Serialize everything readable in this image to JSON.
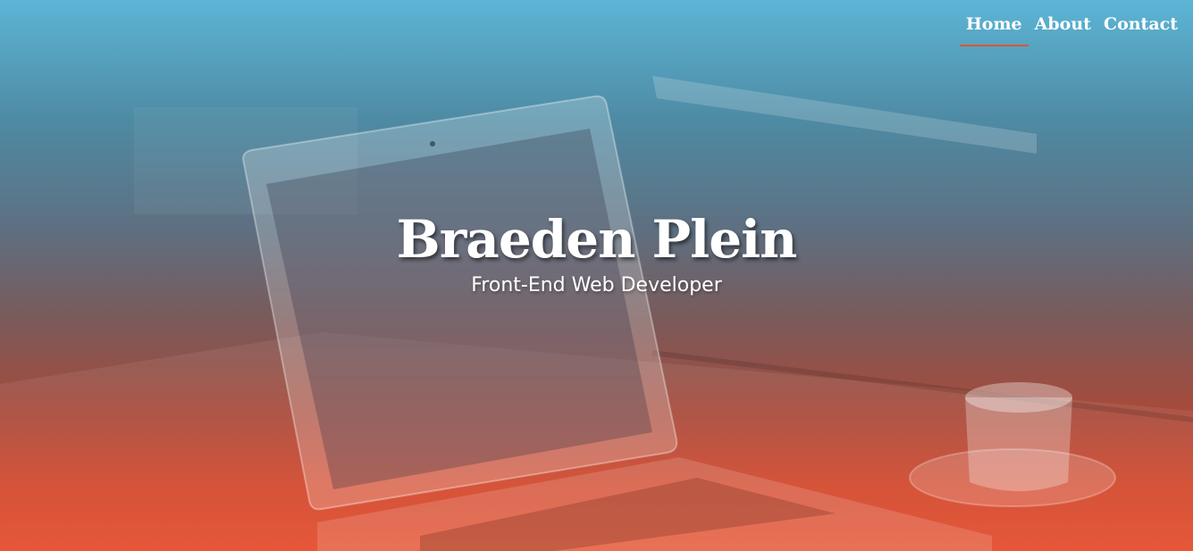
{
  "nav": {
    "items": [
      {
        "label": "Home",
        "active": true
      },
      {
        "label": "About",
        "active": false
      },
      {
        "label": "Contact",
        "active": false
      }
    ]
  },
  "hero": {
    "title": "Braeden Plein",
    "subtitle": "Front-End Web Developer",
    "gradient_top": "#5cb5d6",
    "gradient_bottom": "#e44b28",
    "accent": "#e35232"
  }
}
